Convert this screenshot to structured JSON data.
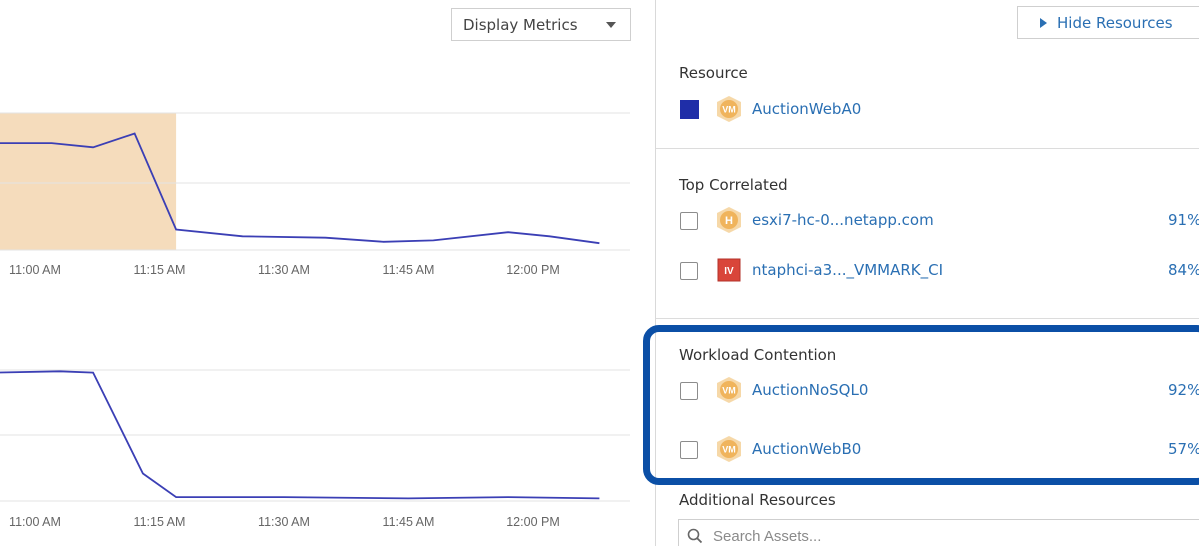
{
  "display_metrics": {
    "label": "Display Metrics"
  },
  "hide_resources": {
    "label": "Hide Resources"
  },
  "resource": {
    "title": "Resource",
    "name": "AuctionWebA0",
    "icon_label": "VM",
    "color": "#1f2ea8"
  },
  "top_correlated": {
    "title": "Top Correlated",
    "items": [
      {
        "name": "esxi7-hc-0...netapp.com",
        "icon_label": "H",
        "icon": "host-icon",
        "pct": "91%"
      },
      {
        "name": "ntaphci-a3..._VMMARK_CI",
        "icon_label": "IV",
        "icon": "internal-volume-icon",
        "pct": "84%"
      }
    ]
  },
  "workload_contention": {
    "title": "Workload Contention",
    "items": [
      {
        "name": "AuctionNoSQL0",
        "icon_label": "VM",
        "icon": "vm-icon",
        "pct": "92%"
      },
      {
        "name": "AuctionWebB0",
        "icon_label": "VM",
        "icon": "vm-icon",
        "pct": "57%"
      }
    ]
  },
  "additional_resources": {
    "title": "Additional Resources",
    "search_placeholder": "Search Assets..."
  },
  "colors": {
    "series": "#3b3fb5",
    "highlight": "#f5dcbc",
    "link": "#2a6fb3",
    "contention_border": "#0b4fa6"
  },
  "chart_data": [
    {
      "type": "line",
      "x_tick_labels": [
        "11:00 AM",
        "11:15 AM",
        "11:30 AM",
        "11:45 AM",
        "12:00 PM"
      ],
      "highlighted_range": [
        "10:55 AM",
        "11:17 AM"
      ],
      "grid": true,
      "series": [
        {
          "x": [
            "10:55 AM",
            "11:02 AM",
            "11:07 AM",
            "11:12 AM",
            "11:17 AM",
            "11:25 AM",
            "11:35 AM",
            "11:42 AM",
            "11:48 AM",
            "11:57 AM",
            "12:02 PM",
            "12:08 PM"
          ],
          "values": [
            0.78,
            0.78,
            0.75,
            0.85,
            0.15,
            0.1,
            0.09,
            0.06,
            0.07,
            0.13,
            0.1,
            0.05
          ]
        }
      ]
    },
    {
      "type": "line",
      "x_tick_labels": [
        "11:00 AM",
        "11:15 AM",
        "11:30 AM",
        "11:45 AM",
        "12:00 PM"
      ],
      "grid": true,
      "series": [
        {
          "x": [
            "10:55 AM",
            "11:03 AM",
            "11:07 AM",
            "11:13 AM",
            "11:17 AM",
            "11:30 AM",
            "11:45 AM",
            "11:57 AM",
            "12:08 PM"
          ],
          "values": [
            0.98,
            0.99,
            0.98,
            0.21,
            0.03,
            0.03,
            0.02,
            0.03,
            0.02
          ]
        }
      ]
    }
  ]
}
